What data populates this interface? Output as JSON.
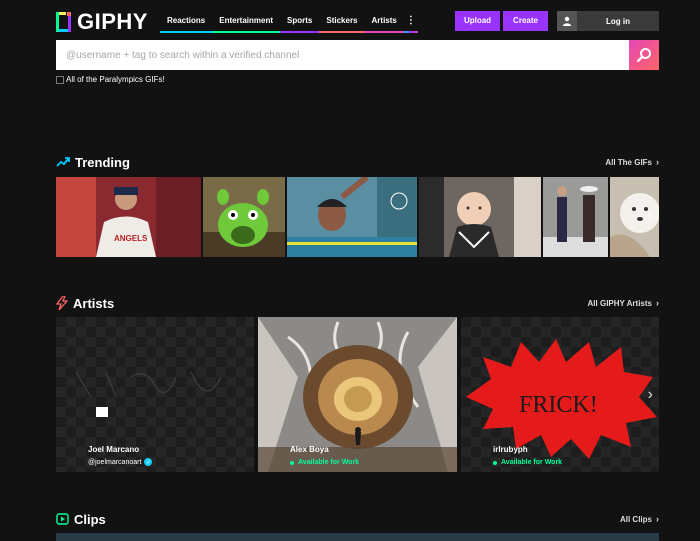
{
  "header": {
    "logo_text": "GIPHY",
    "nav": [
      {
        "label": "Reactions",
        "color": "#00ccff"
      },
      {
        "label": "Entertainment",
        "color": "#00ff99"
      },
      {
        "label": "Sports",
        "color": "#9933ff"
      },
      {
        "label": "Stickers",
        "color": "#ff6666"
      },
      {
        "label": "Artists",
        "color": "#e646b6"
      }
    ],
    "more_glyph": "⋮",
    "upload_label": "Upload",
    "create_label": "Create",
    "login_label": "Log in"
  },
  "search": {
    "placeholder": "@username + tag to search within a verified channel"
  },
  "banner": {
    "alt_text": "All of the Paralympics GIFs!"
  },
  "trending": {
    "title": "Trending",
    "more_label": "All The GIFs",
    "icon": "trending-up-icon"
  },
  "artists": {
    "title": "Artists",
    "more_label": "All GIPHY Artists",
    "icon": "lightning-icon",
    "cards": [
      {
        "name": "Joel Marcano",
        "handle": "@joelmarcanoart",
        "verified": true
      },
      {
        "name": "Alex Boya",
        "status": "Available for Work"
      },
      {
        "name": "irlrubyph",
        "status": "Available for Work",
        "art_text": "FRICK!"
      }
    ]
  },
  "clips": {
    "title": "Clips",
    "more_label": "All Clips",
    "icon": "clips-icon"
  },
  "colors": {
    "background": "#121212",
    "accent_purple": "#9933ff",
    "available_green": "#00ff99"
  }
}
